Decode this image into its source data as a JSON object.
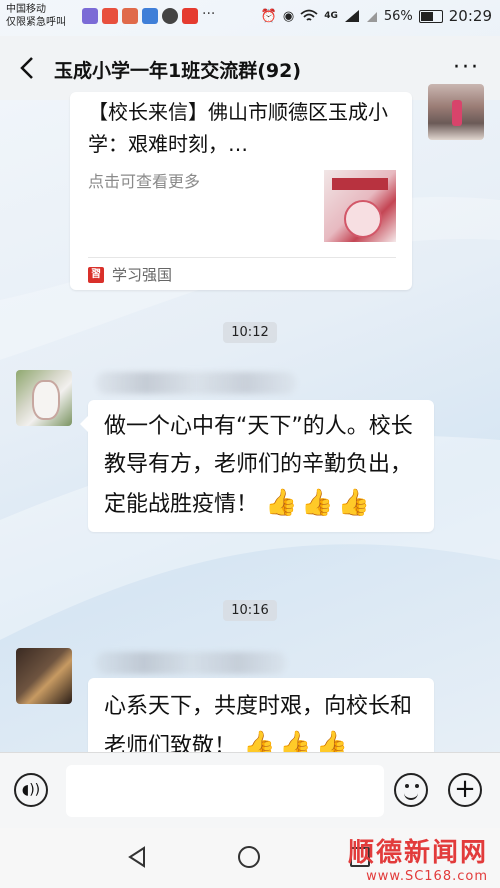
{
  "status_bar": {
    "carrier": "中国移动",
    "emergency": "仅限紧急呼叫",
    "network": "4G",
    "battery": "56%",
    "time": "20:29"
  },
  "header": {
    "title": "玉成小学一年1班交流群(92)",
    "more": "···"
  },
  "card": {
    "title": "【校长来信】佛山市顺德区玉成小学：艰难时刻，…",
    "description": "点击可查看更多",
    "source": "学习强国",
    "source_logo": "習"
  },
  "messages": [
    {
      "time": "10:12",
      "text": "做一个心中有“天下”的人。校长教导有方，老师们的辛勤负出，定能战胜疫情！",
      "emoji": "👍👍👍"
    },
    {
      "time": "10:16",
      "text": "心系天下，共度时艰，向校长和老师们致敬！",
      "emoji": "👍👍👍"
    }
  ],
  "input_bar": {
    "voice_icon": "voice-icon",
    "emoji_icon": "emoji-icon",
    "plus_icon": "plus-icon"
  },
  "watermark": {
    "name": "顺德新闻网",
    "url": "www.SC168.com"
  },
  "colors": {
    "accent_red": "#e23b3b",
    "bubble": "#ffffff"
  }
}
